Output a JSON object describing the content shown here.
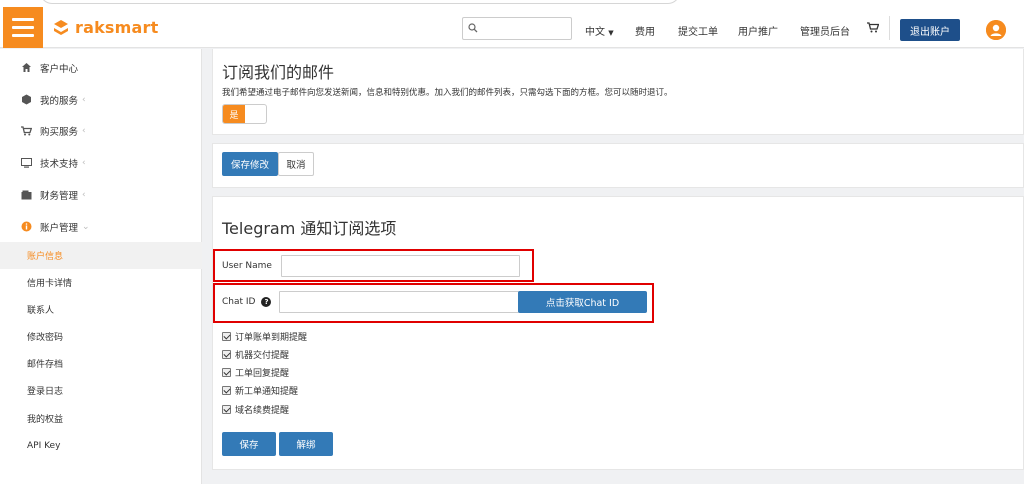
{
  "header": {
    "logo_text": "raksmart",
    "search": {
      "placeholder": "",
      "value": ""
    },
    "nav": {
      "language": "中文",
      "fees": "费用",
      "submit_ticket": "提交工单",
      "affiliate": "用户推广",
      "admin": "管理员后台"
    },
    "logout_label": "退出账户",
    "accent_color": "#f68b1f",
    "logout_color": "#1e4f8a"
  },
  "sidebar": {
    "items": [
      {
        "label": "客户中心",
        "icon": "home-icon"
      },
      {
        "label": "我的服务",
        "icon": "cube-icon"
      },
      {
        "label": "购买服务",
        "icon": "cart-icon"
      },
      {
        "label": "技术支持",
        "icon": "monitor-icon"
      },
      {
        "label": "财务管理",
        "icon": "wallet-icon"
      },
      {
        "label": "账户管理",
        "icon": "info-icon"
      }
    ],
    "sub_items": [
      {
        "label": "账户信息",
        "active": true
      },
      {
        "label": "信用卡详情"
      },
      {
        "label": "联系人"
      },
      {
        "label": "修改密码"
      },
      {
        "label": "邮件存档"
      },
      {
        "label": "登录日志"
      },
      {
        "label": "我的权益"
      },
      {
        "label": "API Key"
      }
    ]
  },
  "newsletter": {
    "title": "订阅我们的邮件",
    "description": "我们希望通过电子邮件向您发送新闻，信息和特别优惠。加入我们的邮件列表，只需勾选下面的方框。您可以随时退订。",
    "toggle_label": "是",
    "toggle_on": true
  },
  "actions": {
    "save_changes": "保存修改",
    "cancel": "取消"
  },
  "telegram": {
    "title": "Telegram 通知订阅选项",
    "username_label": "User Name",
    "username_value": "",
    "chatid_label": "Chat ID",
    "chatid_value": "",
    "get_chatid_button": "点击获取Chat ID",
    "options": [
      {
        "label": "订单账单到期提醒",
        "checked": true
      },
      {
        "label": "机器交付提醒",
        "checked": true
      },
      {
        "label": "工单回复提醒",
        "checked": true
      },
      {
        "label": "新工单通知提醒",
        "checked": true
      },
      {
        "label": "域名续费提醒",
        "checked": true
      }
    ],
    "save_button": "保存",
    "unbind_button": "解绑"
  }
}
